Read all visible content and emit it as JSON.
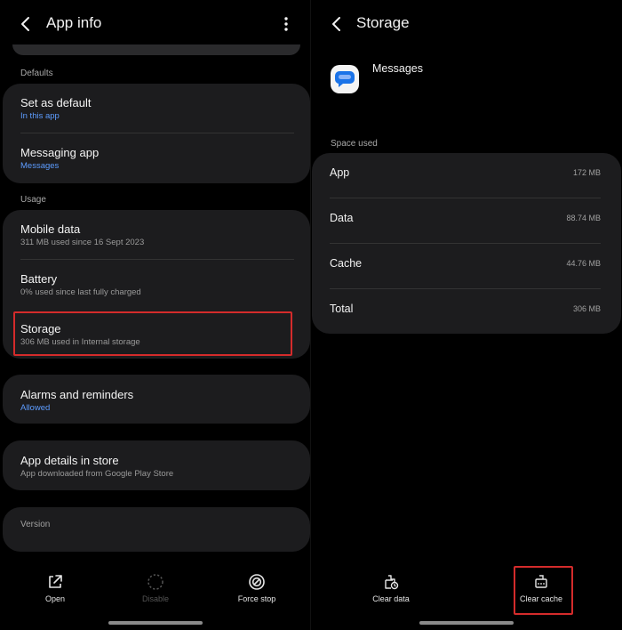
{
  "left": {
    "title": "App info",
    "sections": {
      "defaults": "Defaults",
      "usage": "Usage"
    },
    "rows": {
      "set_default": {
        "title": "Set as default",
        "sub": "In this app"
      },
      "messaging_app": {
        "title": "Messaging app",
        "sub": "Messages"
      },
      "mobile_data": {
        "title": "Mobile data",
        "sub": "311 MB used since 16 Sept 2023"
      },
      "battery": {
        "title": "Battery",
        "sub": "0% used since last fully charged"
      },
      "storage": {
        "title": "Storage",
        "sub": "306 MB used in Internal storage"
      },
      "alarms": {
        "title": "Alarms and reminders",
        "sub": "Allowed"
      },
      "app_details": {
        "title": "App details in store",
        "sub": "App downloaded from Google Play Store"
      },
      "version": {
        "title": "Version"
      }
    },
    "bottom": {
      "open": "Open",
      "disable": "Disable",
      "force_stop": "Force stop"
    }
  },
  "right": {
    "title": "Storage",
    "app_name": "Messages",
    "section": "Space used",
    "items": [
      {
        "label": "App",
        "value": "172 MB"
      },
      {
        "label": "Data",
        "value": "88.74 MB"
      },
      {
        "label": "Cache",
        "value": "44.76 MB"
      },
      {
        "label": "Total",
        "value": "306 MB"
      }
    ],
    "bottom": {
      "clear_data": "Clear data",
      "clear_cache": "Clear cache"
    }
  },
  "colors": {
    "background": "#000000",
    "card": "#1c1c1e",
    "accent_blue": "#5d9cff",
    "highlight_red": "#d42b2b"
  }
}
